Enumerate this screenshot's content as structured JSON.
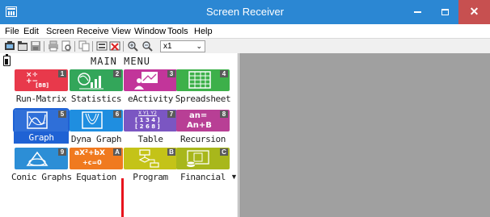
{
  "window": {
    "title": "Screen Receiver",
    "controls": {
      "minimize": "–",
      "close": "✕"
    }
  },
  "menubar": {
    "items": [
      "File",
      "Edit",
      "Screen Receive",
      "View",
      "Window",
      "Tools",
      "Help"
    ]
  },
  "toolbar": {
    "icons": [
      "screen-capture-icon",
      "folder-icon",
      "save-icon",
      "print-icon",
      "print-preview-icon",
      "copy-icon",
      "screen-receive-icon",
      "screen-stop-icon",
      "zoom-in-icon",
      "zoom-out-icon"
    ],
    "zoom_value": "x1"
  },
  "calculator": {
    "header_title": "MAIN MENU",
    "apps": [
      {
        "label": "Run-Matrix",
        "number": "1",
        "color": "#e8394b",
        "icon": "run-matrix-icon",
        "selected": false
      },
      {
        "label": "Statistics",
        "number": "2",
        "color": "#33a65a",
        "icon": "statistics-icon",
        "selected": false
      },
      {
        "label": "eActivity",
        "number": "3",
        "color": "#c2359a",
        "icon": "eactivity-icon",
        "selected": false
      },
      {
        "label": "Spreadsheet",
        "number": "4",
        "color": "#3db04a",
        "icon": "spreadsheet-icon",
        "selected": false
      },
      {
        "label": "Graph",
        "number": "5",
        "color": "#2f6fd8",
        "icon": "graph-icon",
        "selected": true
      },
      {
        "label": "Dyna Graph",
        "number": "6",
        "color": "#1f8ee0",
        "icon": "dyna-graph-icon",
        "selected": false
      },
      {
        "label": "Table",
        "number": "7",
        "color": "#7b56c2",
        "icon": "table-icon",
        "selected": false
      },
      {
        "label": "Recursion",
        "number": "8",
        "color": "#b83f95",
        "icon": "recursion-icon",
        "selected": false
      },
      {
        "label": "Conic Graphs",
        "number": "9",
        "color": "#2c8ed6",
        "icon": "conic-graphs-icon",
        "selected": false
      },
      {
        "label": "Equation",
        "number": "A",
        "color": "#f07a1f",
        "icon": "equation-icon",
        "selected": false
      },
      {
        "label": "Program",
        "number": "B",
        "color": "#c4c318",
        "icon": "program-icon",
        "selected": false
      },
      {
        "label": "Financial",
        "number": "C",
        "color": "#a8b71b",
        "icon": "financial-icon",
        "selected": false
      }
    ],
    "tile_text": {
      "run_top": "×÷",
      "run_mid": "+−",
      "run_box": "[88]",
      "table_row1": "X Y1 Y2",
      "table_row2": "[ 1 3 4 ]",
      "table_row3": "[ 2 6 8 ]",
      "rec_top": "an=",
      "rec_bot": "An+B",
      "eq_top": "aX²+bX",
      "eq_bot": "+c=0"
    },
    "scroll_indicator": "▼"
  },
  "colors": {
    "titlebar": "#2b87d3",
    "selection": "#1f62d4",
    "cursor_marker": "#e8131d",
    "workspace": "#a0a0a0"
  }
}
